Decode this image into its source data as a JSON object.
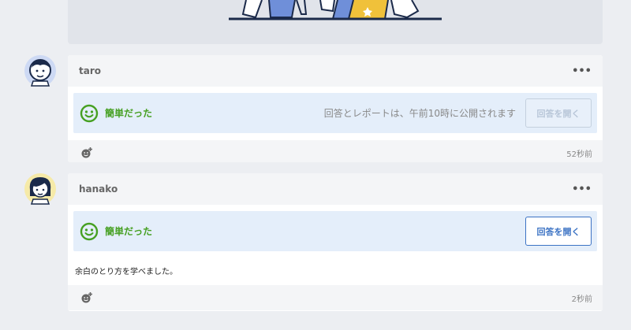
{
  "colors": {
    "background": "#eceef2",
    "accent_green": "#46a022",
    "accent_blue": "#3c73c4",
    "band": "#e4eefa"
  },
  "posts": [
    {
      "user": "taro",
      "more_icon": "ellipsis-icon",
      "result": "簡単だった",
      "notice": "回答とレポートは、午前10時に公開されます",
      "open_button": "回答を開く",
      "open_button_state": "disabled",
      "reaction_icon": "add-reaction-icon",
      "time": "52秒前"
    },
    {
      "user": "hanako",
      "more_icon": "ellipsis-icon",
      "result": "簡単だった",
      "open_button": "回答を開く",
      "open_button_state": "enabled",
      "comment": "余白のとり方を学べました。",
      "reaction_icon": "add-reaction-icon",
      "time": "2秒前"
    }
  ]
}
